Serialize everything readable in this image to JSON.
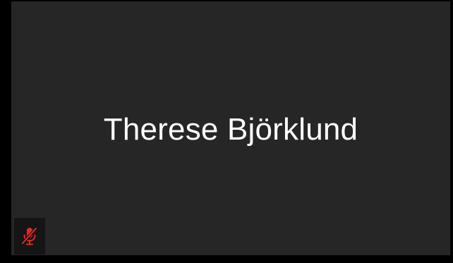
{
  "participant": {
    "name": "Therese Björklund",
    "mic_icon": "mic-off-icon",
    "mic_status_color": "#e0282e",
    "tile_background": "#262626"
  }
}
